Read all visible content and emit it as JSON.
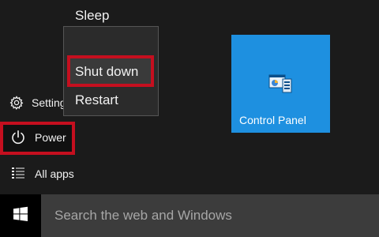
{
  "rail": {
    "settings_label": "Settings",
    "power_label": "Power",
    "allapps_label": "All apps"
  },
  "power_menu": {
    "sleep_label": "Sleep",
    "shutdown_label": "Shut down",
    "restart_label": "Restart"
  },
  "tiles": {
    "control_panel_label": "Control Panel"
  },
  "taskbar": {
    "search_placeholder": "Search the web and Windows"
  },
  "colors": {
    "accent_tile": "#1e90e0",
    "highlight_border": "#c50f1f",
    "start_background": "#1b1b1b",
    "taskbar": "#000000",
    "search_box": "#3c3c3c"
  },
  "icons": {
    "settings": "gear-icon",
    "power": "power-icon",
    "all_apps": "list-icon",
    "control_panel": "control-panel-icon",
    "start": "windows-logo-icon"
  }
}
